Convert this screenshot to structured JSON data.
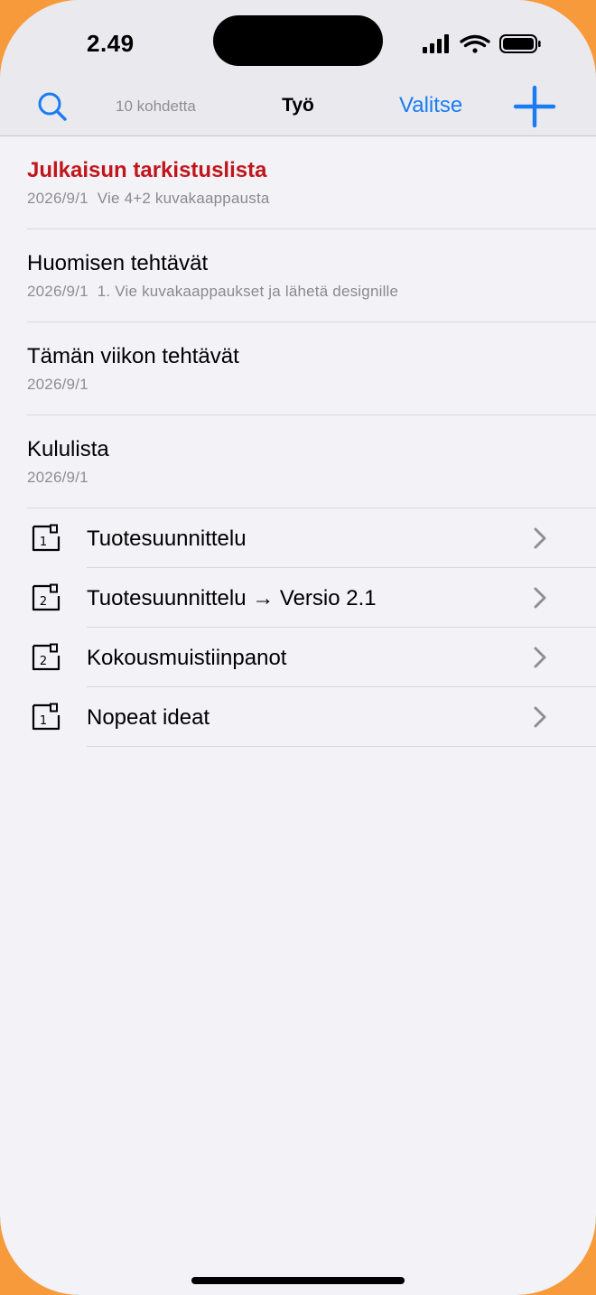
{
  "status_bar": {
    "time": "2.49"
  },
  "nav": {
    "item_count": "10 kohdetta",
    "title": "Työ",
    "select_label": "Valitse",
    "accent_color": "#1a7cf2"
  },
  "notes": [
    {
      "title": "Julkaisun tarkistuslista",
      "date": "2026/9/1",
      "preview": "Vie 4+2 kuvakaappausta",
      "title_color": "#c0161b"
    },
    {
      "title": "Huomisen tehtävät",
      "date": "2026/9/1",
      "preview": "1. Vie kuvakaappaukset ja lähetä designille"
    },
    {
      "title": "Tämän viikon tehtävät",
      "date": "2026/9/1",
      "preview": ""
    },
    {
      "title": "Kululista",
      "date": "2026/9/1",
      "preview": ""
    }
  ],
  "folders": [
    {
      "name": "Tuotesuunnittelu",
      "badge": "1",
      "icon": "folder-badge-icon"
    },
    {
      "name": "Tuotesuunnittelu → Versio 2.1",
      "badge": "2",
      "icon": "folder-badge-icon"
    },
    {
      "name": "Kokousmuistiinpanot",
      "badge": "2",
      "icon": "folder-badge-icon"
    },
    {
      "name": "Nopeat ideat",
      "badge": "1",
      "icon": "folder-badge-icon"
    }
  ]
}
